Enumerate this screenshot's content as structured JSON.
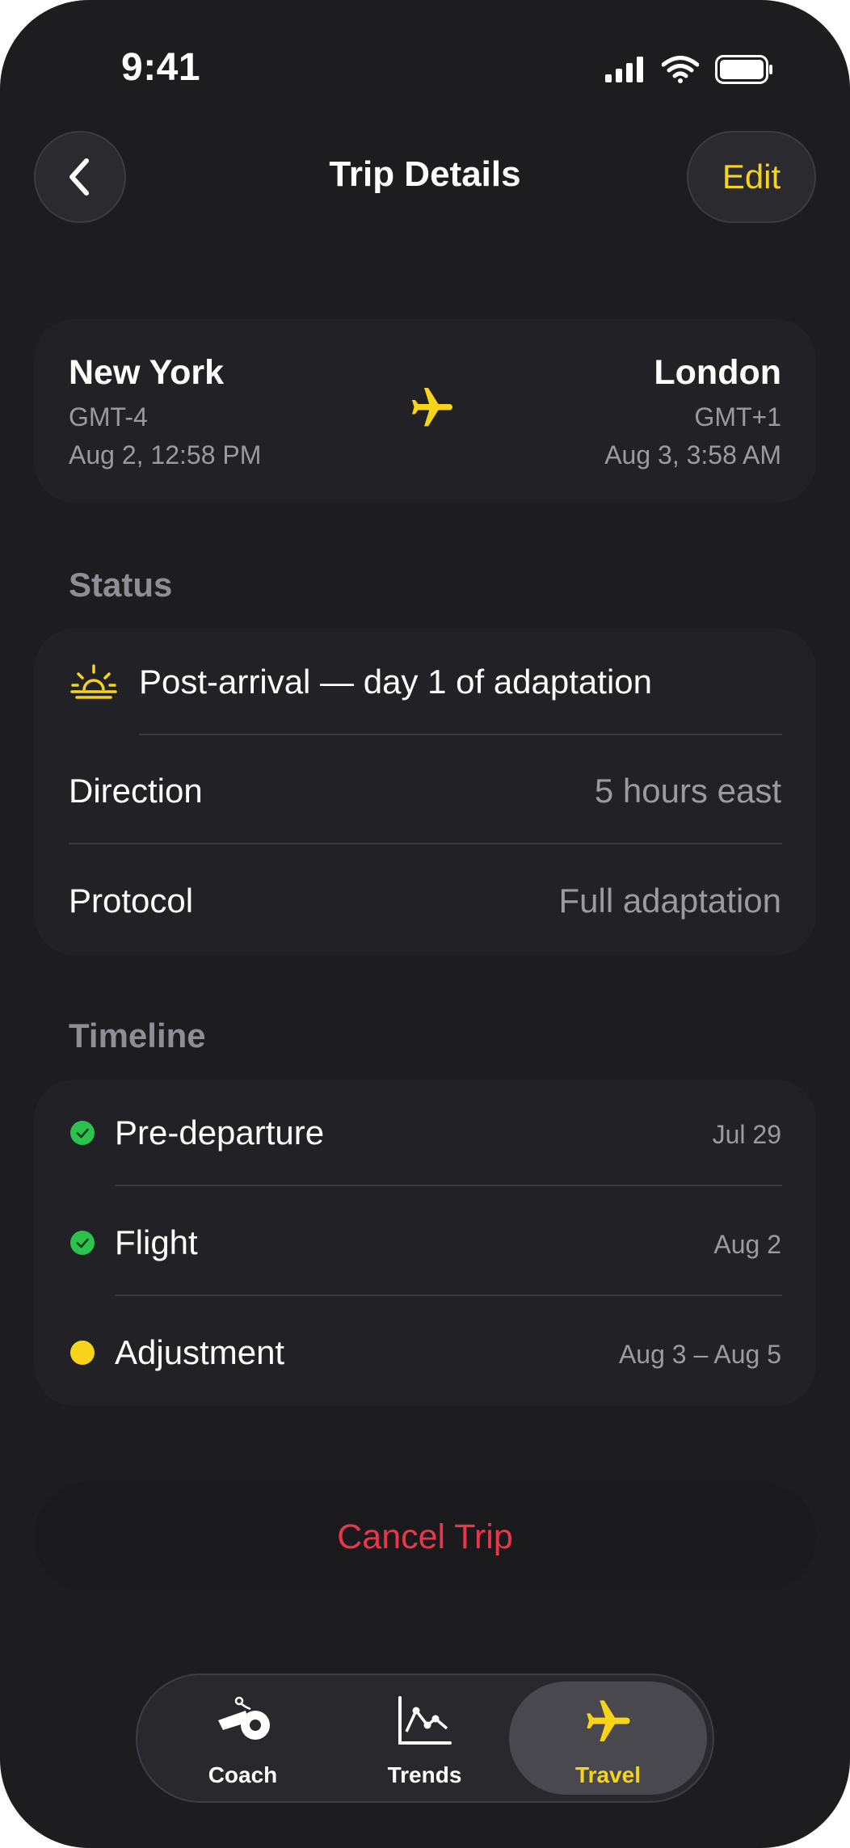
{
  "status_bar": {
    "time": "9:41"
  },
  "header": {
    "title": "Trip Details",
    "edit_label": "Edit"
  },
  "route": {
    "origin": {
      "city": "New York",
      "timezone": "GMT-4",
      "datetime": "Aug 2, 12:58 PM"
    },
    "destination": {
      "city": "London",
      "timezone": "GMT+1",
      "datetime": "Aug 3, 3:58 AM"
    }
  },
  "status": {
    "section_label": "Status",
    "phase_text": "Post-arrival — day 1 of adaptation",
    "rows": [
      {
        "label": "Direction",
        "value": "5 hours east"
      },
      {
        "label": "Protocol",
        "value": "Full adaptation"
      }
    ]
  },
  "timeline": {
    "section_label": "Timeline",
    "items": [
      {
        "label": "Pre-departure",
        "date": "Jul 29",
        "state": "done"
      },
      {
        "label": "Flight",
        "date": "Aug 2",
        "state": "done"
      },
      {
        "label": "Adjustment",
        "date": "Aug 3 – Aug 5",
        "state": "active"
      }
    ]
  },
  "actions": {
    "cancel_label": "Cancel Trip"
  },
  "tabbar": {
    "tabs": [
      {
        "label": "Coach",
        "icon": "whistle-icon"
      },
      {
        "label": "Trends",
        "icon": "chart-icon"
      },
      {
        "label": "Travel",
        "icon": "airplane-icon",
        "active": true
      }
    ]
  },
  "colors": {
    "accent": "#f7d419",
    "success": "#2bc24d",
    "danger": "#e8374a",
    "background": "#1d1d20",
    "card": "#222226"
  }
}
